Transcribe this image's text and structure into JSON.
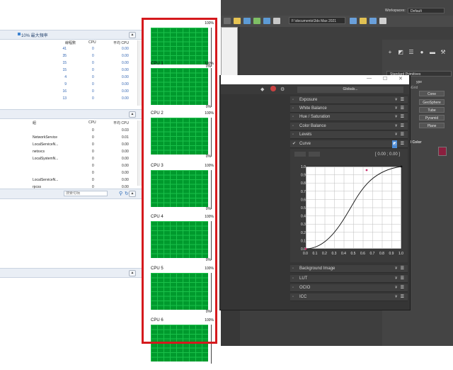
{
  "resmon": {
    "cpu_section": {
      "title": "10% 最大頻率",
      "columns": [
        "線程數",
        "CPU",
        "平均 CPU"
      ],
      "rows": [
        {
          "threads": "41",
          "cpu": "0",
          "avg": "0.00"
        },
        {
          "threads": "35",
          "cpu": "0",
          "avg": "0.00"
        },
        {
          "threads": "15",
          "cpu": "0",
          "avg": "0.00"
        },
        {
          "threads": "15",
          "cpu": "0",
          "avg": "0.00"
        },
        {
          "threads": "4",
          "cpu": "0",
          "avg": "0.00"
        },
        {
          "threads": "9",
          "cpu": "0",
          "avg": "0.00"
        },
        {
          "threads": "16",
          "cpu": "0",
          "avg": "0.00"
        },
        {
          "threads": "13",
          "cpu": "0",
          "avg": "0.00"
        }
      ]
    },
    "services_section": {
      "columns": [
        "組",
        "CPU",
        "平均 CPU"
      ],
      "rows": [
        {
          "group": "",
          "cpu": "0",
          "avg": "0.03"
        },
        {
          "group": "NetworkService",
          "cpu": "0",
          "avg": "0.01"
        },
        {
          "group": "LocalServiceN...",
          "cpu": "0",
          "avg": "0.00"
        },
        {
          "group": "netsvcs",
          "cpu": "0",
          "avg": "0.00"
        },
        {
          "group": "LocalSystemN...",
          "cpu": "0",
          "avg": "0.00"
        },
        {
          "group": "",
          "cpu": "0",
          "avg": "0.00"
        },
        {
          "group": "",
          "cpu": "0",
          "avg": "0.00"
        },
        {
          "group": "LocalServiceN...",
          "cpu": "0",
          "avg": "0.00"
        },
        {
          "group": "rpcss",
          "cpu": "0",
          "avg": "0.00"
        }
      ]
    },
    "search_placeholder": "搜索句柄"
  },
  "cpu_graphs": [
    {
      "label": "",
      "max": "100%",
      "min": "0%"
    },
    {
      "label": "CPU 1",
      "max": "100%",
      "min": "0%"
    },
    {
      "label": "CPU 2",
      "max": "100%",
      "min": "0%"
    },
    {
      "label": "CPU 3",
      "max": "100%",
      "min": "0%"
    },
    {
      "label": "CPU 4",
      "max": "100%",
      "min": "0%"
    },
    {
      "label": "CPU 5",
      "max": "100%",
      "min": "0%"
    },
    {
      "label": "CPU 6",
      "max": "100%",
      "min": ""
    }
  ],
  "max": {
    "workspaces_label": "Workspaces:",
    "workspace_value": "Default",
    "path": "F:\\documents\\3ds Max 2021",
    "command_panel": {
      "dropdown": "Standard Primitives",
      "object_type_label": "ype",
      "autogrid_label": "oGrid",
      "buttons": [
        "Cone",
        "GeoSphere",
        "Tube",
        "Pyramid",
        "Plane"
      ],
      "name_color_label": "d Color"
    },
    "vfb": {
      "globals_label": "Globals...",
      "layers_top": [
        "Exposure",
        "White Balance",
        "Hue / Saturation",
        "Color Balance",
        "Levels"
      ],
      "curve_label": "Curve",
      "curve_readout": "[ 0.00 ; 0.00 ]",
      "curve_x_ticks": [
        "0.0",
        "0.1",
        "0.2",
        "0.3",
        "0.4",
        "0.5",
        "0.6",
        "0.7",
        "0.8",
        "0.9",
        "1.0"
      ],
      "curve_y_ticks": [
        "1.0",
        "0.9",
        "0.8",
        "0.7",
        "0.6",
        "0.5",
        "0.4",
        "0.3",
        "0.2",
        "0.1",
        "0.0"
      ],
      "layers_bottom": [
        "Background Image",
        "LUT",
        "OCIO",
        "ICC"
      ]
    }
  },
  "colors": {
    "highlight": "#d5191d",
    "cpu_graph_bg": "#009a2d",
    "cpu_graph_grid": "#1ac14a",
    "vfb_bg": "#353535"
  }
}
